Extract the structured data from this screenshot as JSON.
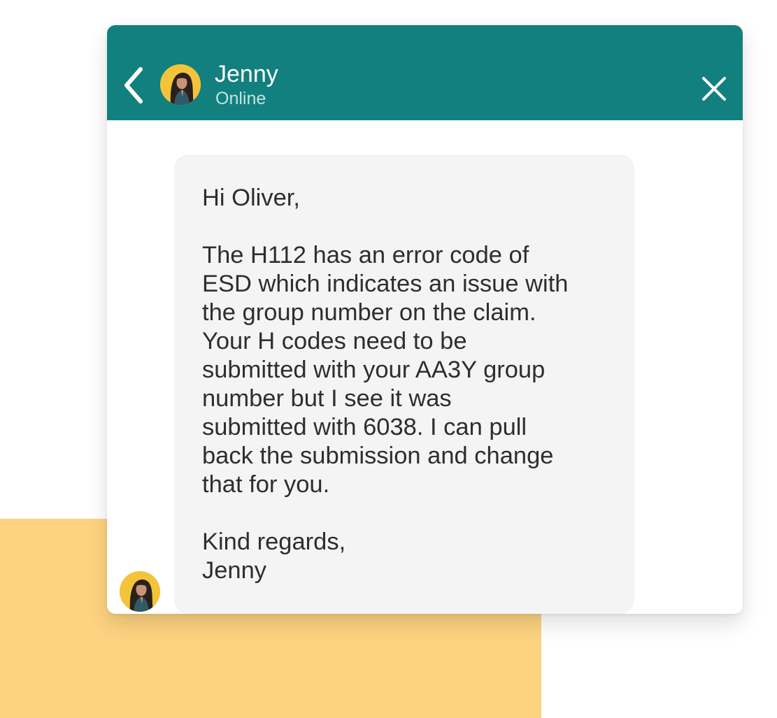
{
  "colors": {
    "header_bg": "#12807e",
    "backdrop": "#fdd381",
    "bubble_bg": "#f4f4f4",
    "avatar_bg": "#f3c43a",
    "text": "#2e2e2e"
  },
  "header": {
    "back_icon": "chevron-left-icon",
    "contact_name": "Jenny",
    "status": "Online",
    "close_icon": "close-icon"
  },
  "message": {
    "sender": "Jenny",
    "greeting": "Hi Oliver,",
    "body_lines": [
      "The H112 has an error code of",
      "ESD which indicates an issue with",
      "the group number on the claim.",
      "Your H codes need to be",
      "submitted with your AA3Y group",
      "number but I see it was",
      "submitted with 6038. I can pull",
      "back the submission and change",
      "that for you."
    ],
    "signoff": "Kind regards,",
    "signature": "Jenny"
  }
}
